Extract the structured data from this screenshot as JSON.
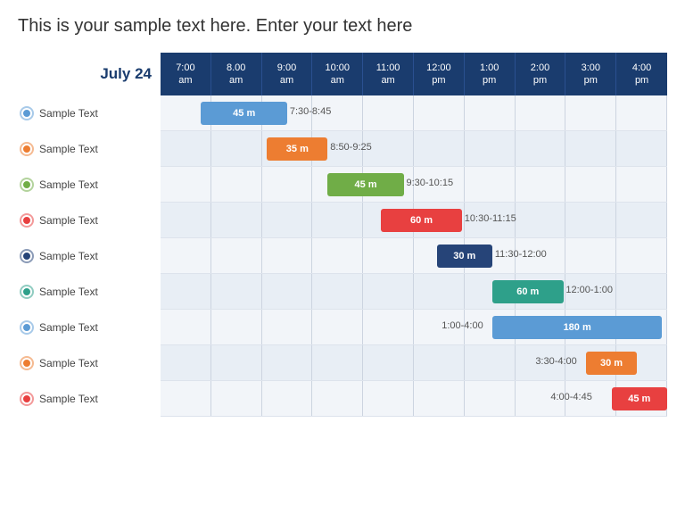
{
  "title": "This is your sample text here. Enter your text here",
  "date_label": "July 24",
  "time_columns": [
    {
      "label": "7:00",
      "sub": "am"
    },
    {
      "label": "8.00",
      "sub": "am"
    },
    {
      "label": "9:00",
      "sub": "am"
    },
    {
      "label": "10:00",
      "sub": "am"
    },
    {
      "label": "11:00",
      "sub": "am"
    },
    {
      "label": "12:00",
      "sub": "pm"
    },
    {
      "label": "1:00",
      "sub": "pm"
    },
    {
      "label": "2:00",
      "sub": "pm"
    },
    {
      "label": "3:00",
      "sub": "pm"
    },
    {
      "label": "4:00",
      "sub": "pm"
    }
  ],
  "rows": [
    {
      "label": "Sample Text",
      "dot_color": "#5b9bd5",
      "bar_color": "#5b9bd5",
      "bar_text": "45 m",
      "bar_label": "7:30-8:45",
      "bar_start_pct": 8.0,
      "bar_width_pct": 17.0
    },
    {
      "label": "Sample Text",
      "dot_color": "#ed7d31",
      "bar_color": "#ed7d31",
      "bar_text": "35 m",
      "bar_label": "8:50-9:25",
      "bar_start_pct": 21.0,
      "bar_width_pct": 12.0
    },
    {
      "label": "Sample Text",
      "dot_color": "#70ad47",
      "bar_color": "#70ad47",
      "bar_text": "45 m",
      "bar_label": "9:30-10:15",
      "bar_start_pct": 33.0,
      "bar_width_pct": 15.0
    },
    {
      "label": "Sample Text",
      "dot_color": "#e84040",
      "bar_color": "#e84040",
      "bar_text": "60 m",
      "bar_label": "10:30-11:15",
      "bar_start_pct": 43.5,
      "bar_width_pct": 16.0
    },
    {
      "label": "Sample Text",
      "dot_color": "#264478",
      "bar_color": "#264478",
      "bar_text": "30 m",
      "bar_label": "11:30-12:00",
      "bar_start_pct": 54.5,
      "bar_width_pct": 11.0
    },
    {
      "label": "Sample Text",
      "dot_color": "#2ea08a",
      "bar_color": "#2ea08a",
      "bar_text": "60 m",
      "bar_label": "12:00-1:00",
      "bar_start_pct": 65.5,
      "bar_width_pct": 14.0
    },
    {
      "label": "Sample Text",
      "dot_color": "#5b9bd5",
      "bar_color": "#5b9bd5",
      "bar_text": "180 m",
      "bar_label": "1:00-4:00",
      "bar_start_pct": 65.5,
      "bar_width_pct": 33.5
    },
    {
      "label": "Sample Text",
      "dot_color": "#ed7d31",
      "bar_color": "#ed7d31",
      "bar_text": "30 m",
      "bar_label": "3:30-4:00",
      "bar_start_pct": 84.0,
      "bar_width_pct": 10.0
    },
    {
      "label": "Sample Text",
      "dot_color": "#e84040",
      "bar_color": "#e84040",
      "bar_text": "45 m",
      "bar_label": "4:00-4:45",
      "bar_start_pct": 89.0,
      "bar_width_pct": 11.0
    }
  ],
  "row7_label_left": "1:00-4:00",
  "row8_label_left": "3:30-4:00",
  "row9_label_left": "4:00-4:45"
}
